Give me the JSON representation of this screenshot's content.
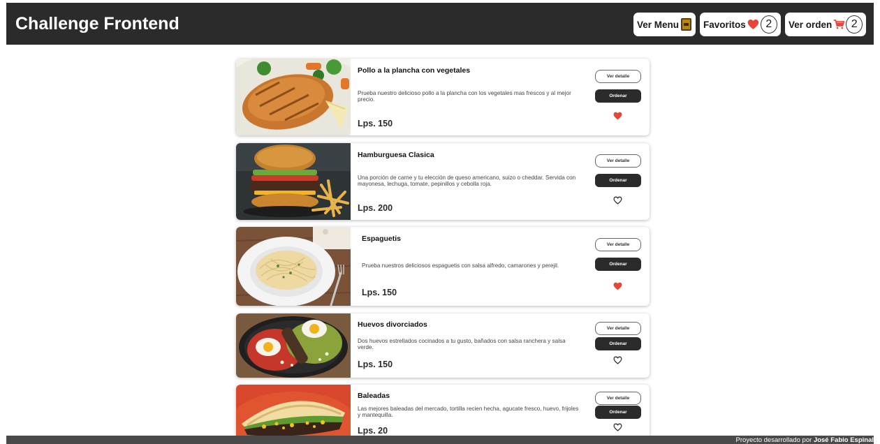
{
  "header": {
    "title": "Challenge Frontend",
    "menu_label": "Ver Menu",
    "favorites_label": "Favoritos",
    "favorites_count": "2",
    "order_label": "Ver orden",
    "order_count": "2",
    "icons": {
      "menu": "menu-book-icon",
      "favorites": "heart-icon",
      "order": "cart-icon"
    },
    "colors": {
      "bar": "#2b2b2b",
      "heart": "#e8443a",
      "cart": "#e8443a"
    }
  },
  "actions": {
    "detail_label": "Ver detalle",
    "order_label": "Ordenar"
  },
  "products": [
    {
      "name": "Pollo a la plancha con vegetales",
      "description": "Prueba nuestro delicioso pollo a la plancha con los vegetales mas frescos y al mejor precio.",
      "price": "Lps. 150",
      "favorite": true
    },
    {
      "name": "Hamburguesa Clasica",
      "description": "Una porción de carne y tu elección de queso americano, suizo o cheddar. Servida con mayonesa, lechuga, tomate, pepinillos y cebolla roja.",
      "price": "Lps. 200",
      "favorite": false
    },
    {
      "name": "Espaguetis",
      "description": "Prueba nuestros deliciosos espaguetis con salsa alfredo, camarones y perejil.",
      "price": "Lps. 150",
      "favorite": true
    },
    {
      "name": "Huevos divorciados",
      "description": "Dos huevos estrellados cocinados a tu gusto, bañados con salsa ranchera y salsa verde.",
      "price": "Lps. 150",
      "favorite": false
    },
    {
      "name": "Baleadas",
      "description": "Las mejores baleadas del mercado, tortilla recien hecha, agucate fresco, huevo, frijoles y mantequilla.",
      "price": "Lps. 20",
      "favorite": false
    }
  ],
  "footer": {
    "prefix": "Proyecto desarrollado por",
    "author": "José Fabio Espinal"
  }
}
